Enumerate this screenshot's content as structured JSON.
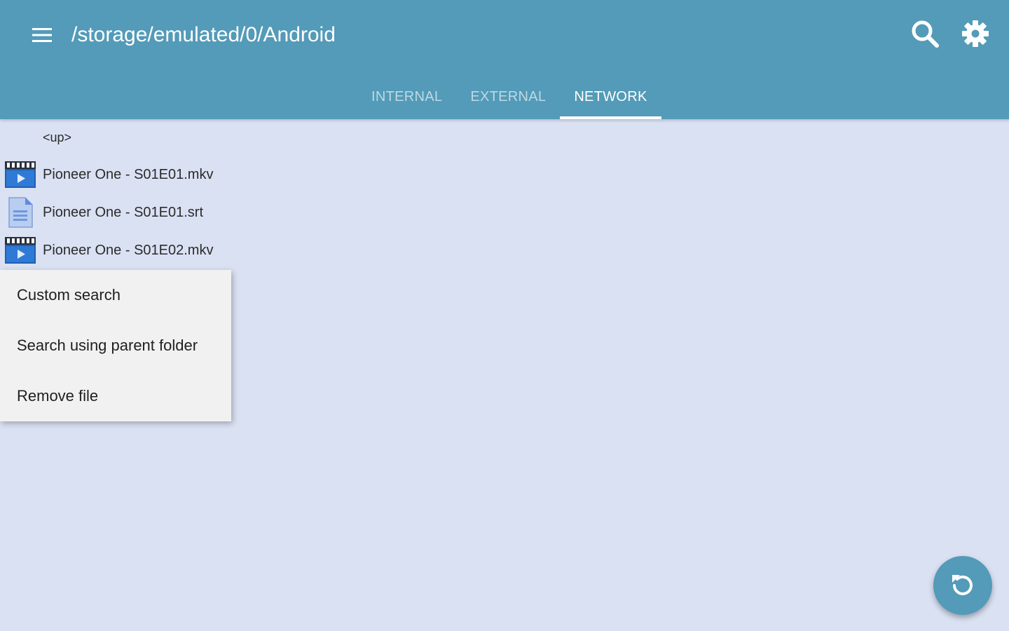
{
  "header": {
    "title": "/storage/emulated/0/Android",
    "menu_icon": "hamburger-menu-icon",
    "search_icon": "search-icon",
    "settings_icon": "gear-icon"
  },
  "tabs": [
    {
      "label": "INTERNAL",
      "active": false
    },
    {
      "label": "EXTERNAL",
      "active": false
    },
    {
      "label": "NETWORK",
      "active": true
    }
  ],
  "files": [
    {
      "name": "<up>",
      "icon": "none"
    },
    {
      "name": "Pioneer One - S01E01.mkv",
      "icon": "video-file-icon"
    },
    {
      "name": "Pioneer One - S01E01.srt",
      "icon": "text-file-icon"
    },
    {
      "name": "Pioneer One - S01E02.mkv",
      "icon": "video-file-icon"
    }
  ],
  "context_menu": {
    "items": [
      {
        "label": "Custom search"
      },
      {
        "label": "Search using parent folder"
      },
      {
        "label": "Remove file"
      }
    ]
  },
  "fab": {
    "icon": "refresh-icon"
  },
  "colors": {
    "primary": "#539bb8",
    "background": "#dae1f3",
    "menu_background": "#f1f1f1"
  }
}
